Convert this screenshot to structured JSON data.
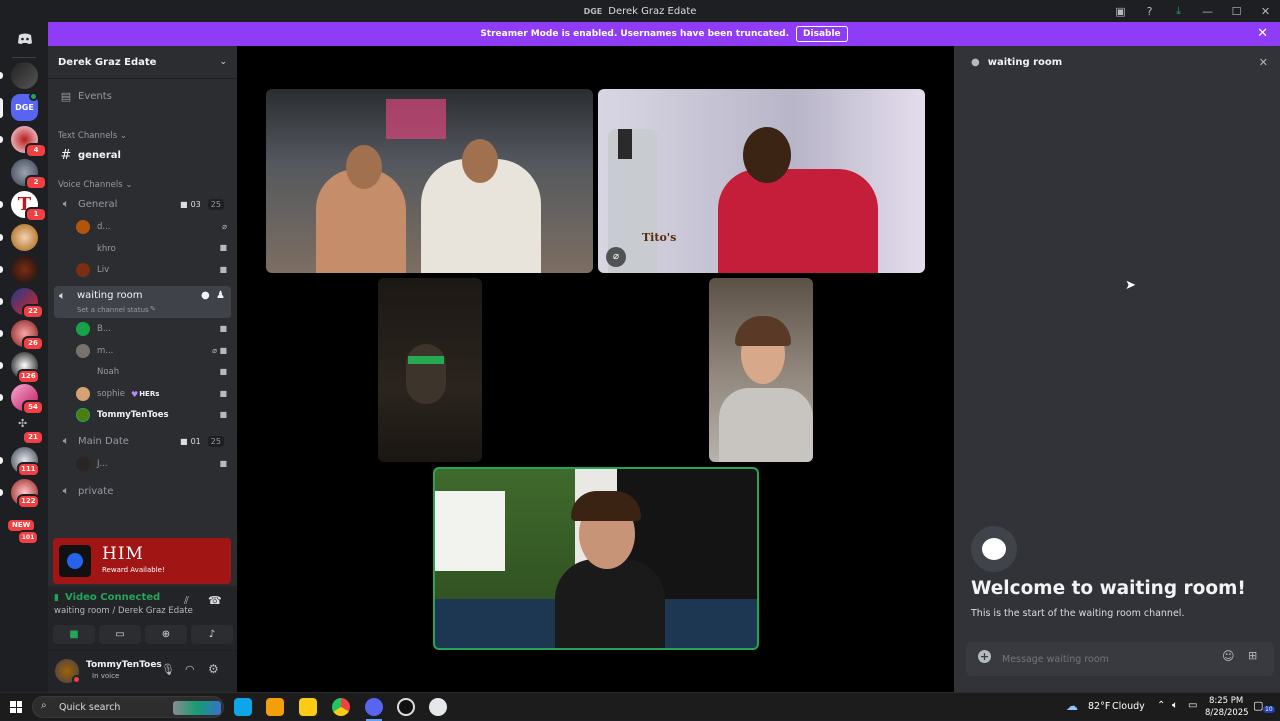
{
  "window": {
    "title": "Derek Graz Edate",
    "logo": "DGE"
  },
  "banner": {
    "text": "Streamer Mode is enabled. Usernames have been truncated.",
    "button": "Disable"
  },
  "servers": [
    {
      "label": "",
      "badge": ""
    },
    {
      "label": "DGE",
      "badge": ""
    },
    {
      "label": "",
      "badge": "4"
    },
    {
      "label": "",
      "badge": "2"
    },
    {
      "label": "T",
      "badge": "1"
    },
    {
      "label": "",
      "badge": ""
    },
    {
      "label": "",
      "badge": ""
    },
    {
      "label": "",
      "badge": "22"
    },
    {
      "label": "",
      "badge": "26"
    },
    {
      "label": "",
      "badge": "126"
    },
    {
      "label": "",
      "badge": "54"
    },
    {
      "label": "",
      "badge": "21"
    },
    {
      "label": "",
      "badge": "111"
    },
    {
      "label": "",
      "badge": "122"
    },
    {
      "label": "NEW",
      "badge": "101"
    }
  ],
  "guild": {
    "name": "Derek Graz Edate"
  },
  "sidebar": {
    "events": "Events",
    "text_category": "Text Channels",
    "general_text": "general",
    "voice_category": "Voice Channels",
    "general_voice": {
      "name": "General",
      "cams": "03",
      "count": "25"
    },
    "general_users": [
      "d...",
      "khro",
      "Liv"
    ],
    "waiting_room": {
      "name": "waiting room",
      "status": "Set a channel status"
    },
    "waiting_users": [
      "B...",
      "m...",
      "Noah",
      "sophie",
      "TommyTenToes"
    ],
    "sophie_tag": "HERs",
    "main_date": {
      "name": "Main Date",
      "cams": "01",
      "count": "25"
    },
    "main_users": [
      "J..."
    ],
    "private": "private"
  },
  "promo": {
    "title": "HIM",
    "subtitle": "Reward Available!"
  },
  "voice_panel": {
    "status": "Video Connected",
    "location": "waiting room / Derek Graz Edate"
  },
  "user_panel": {
    "name": "TommyTenToes",
    "status": "In voice"
  },
  "right_panel": {
    "title": "waiting room",
    "welcome": "Welcome to waiting room!",
    "subtitle": "This is the start of the waiting room channel.",
    "placeholder": "Message waiting room"
  },
  "taskbar": {
    "search": "Quick search",
    "weather": "82°F",
    "condition": "Cloudy",
    "time": "8:25 PM",
    "date": "8/28/2025",
    "mail_badge": "10"
  },
  "video_tile_label": "Tito's"
}
